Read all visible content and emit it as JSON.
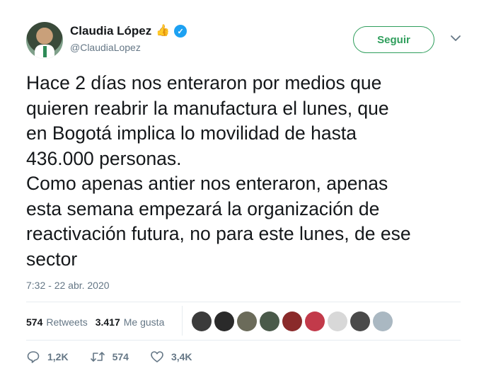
{
  "author": {
    "name": "Claudia López",
    "handle": "@ClaudiaLopez",
    "emoji": "👍",
    "follow_label": "Seguir"
  },
  "tweet": {
    "text": "Hace 2 días nos enteraron por medios que\nquieren reabrir la manufactura el lunes, que\nen Bogotá implica lo movilidad de hasta\n436.000 personas.\nComo apenas antier nos enteraron,  apenas\nesta semana empezará la organización de\nreactivación futura, no para este lunes, de ese\nsector",
    "timestamp": "7:32 - 22 abr. 2020"
  },
  "stats": {
    "retweets_count": "574",
    "retweets_label": "Retweets",
    "likes_count": "3.417",
    "likes_label": "Me gusta"
  },
  "liker_avatar_colors": [
    "#3b3b3b",
    "#2a2a2a",
    "#6b6b5a",
    "#4a5a4a",
    "#8a2a2a",
    "#c23a4a",
    "#d8d8d8",
    "#4a4a4a",
    "#aab8c2"
  ],
  "actions": {
    "reply_count": "1,2K",
    "retweet_count": "574",
    "like_count": "3,4K"
  },
  "colors": {
    "accent_green": "#2f9e5c",
    "verified_blue": "#1da1f2",
    "muted_text": "#657786"
  }
}
